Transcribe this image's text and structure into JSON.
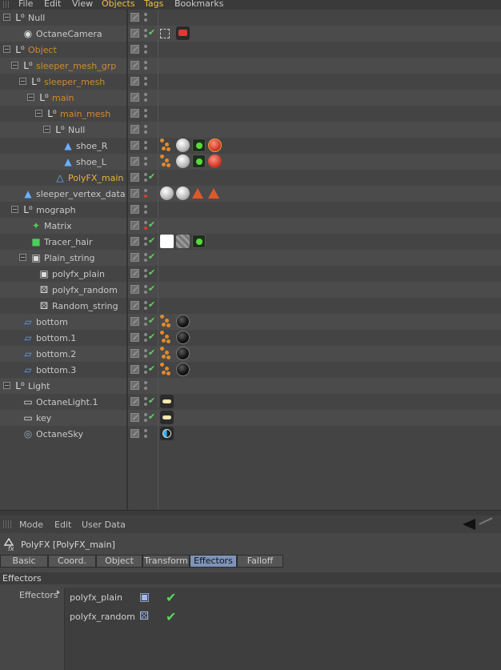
{
  "menubar": {
    "items": [
      "File",
      "Edit",
      "View",
      "Objects",
      "Tags",
      "Bookmarks"
    ]
  },
  "object_manager": {
    "rows": [
      {
        "name": "Null",
        "kind": "null",
        "color": "plain",
        "tags": []
      },
      {
        "name": "OctaneCamera",
        "kind": "camera",
        "color": "plain",
        "tags": [
          "focus",
          "redcam"
        ]
      },
      {
        "name": "Object",
        "kind": "null",
        "color": "orange",
        "tags": []
      },
      {
        "name": "sleeper_mesh_grp",
        "kind": "null",
        "color": "orange",
        "tags": []
      },
      {
        "name": "sleeper_mesh",
        "kind": "null",
        "color": "orange",
        "tags": []
      },
      {
        "name": "main",
        "kind": "null",
        "color": "orange",
        "tags": []
      },
      {
        "name": "main_mesh",
        "kind": "null",
        "color": "orange",
        "tags": []
      },
      {
        "name": "Null",
        "kind": "null",
        "color": "plain",
        "tags": []
      },
      {
        "name": "shoe_R",
        "kind": "poly",
        "color": "plain",
        "tags": [
          "orange-dots",
          "sphere-w",
          "green",
          "red-sel"
        ]
      },
      {
        "name": "shoe_L",
        "kind": "poly",
        "color": "plain",
        "tags": [
          "orange-dots",
          "sphere-w",
          "green",
          "red"
        ]
      },
      {
        "name": "PolyFX_main",
        "kind": "polyfx",
        "color": "yellow",
        "tags": []
      },
      {
        "name": "sleeper_vertex_data",
        "kind": "poly",
        "color": "plain",
        "tags": [
          "sphere-w",
          "sphere-w",
          "tri",
          "tri"
        ]
      },
      {
        "name": "mograph",
        "kind": "null",
        "color": "plain",
        "tags": []
      },
      {
        "name": "Matrix",
        "kind": "matrix",
        "color": "plain",
        "tags": []
      },
      {
        "name": "Tracer_hair",
        "kind": "tracer",
        "color": "plain",
        "tags": [
          "whitebox",
          "hatch",
          "green"
        ]
      },
      {
        "name": "Plain_string",
        "kind": "plain",
        "color": "plain",
        "tags": []
      },
      {
        "name": "polyfx_plain",
        "kind": "plain",
        "color": "plain",
        "tags": []
      },
      {
        "name": "polyfx_random",
        "kind": "random",
        "color": "plain",
        "tags": []
      },
      {
        "name": "Random_string",
        "kind": "random",
        "color": "plain",
        "tags": []
      },
      {
        "name": "bottom",
        "kind": "plane",
        "color": "plain",
        "tags": [
          "orange-dots",
          "sphere-k"
        ]
      },
      {
        "name": "bottom.1",
        "kind": "plane",
        "color": "plain",
        "tags": [
          "orange-dots",
          "sphere-k"
        ]
      },
      {
        "name": "bottom.2",
        "kind": "plane",
        "color": "plain",
        "tags": [
          "orange-dots",
          "sphere-k"
        ]
      },
      {
        "name": "bottom.3",
        "kind": "plane",
        "color": "plain",
        "tags": [
          "orange-dots",
          "sphere-k"
        ]
      },
      {
        "name": "Light",
        "kind": "null",
        "color": "plain",
        "tags": []
      },
      {
        "name": "OctaneLight.1",
        "kind": "light",
        "color": "plain",
        "tags": [
          "light"
        ]
      },
      {
        "name": "key",
        "kind": "light",
        "color": "plain",
        "tags": [
          "light"
        ]
      },
      {
        "name": "OctaneSky",
        "kind": "sky",
        "color": "plain",
        "tags": [
          "sky"
        ]
      }
    ]
  },
  "attribute_manager": {
    "menu": [
      "Mode",
      "Edit",
      "User Data"
    ],
    "object_title": "PolyFX [PolyFX_main]",
    "tabs": [
      "Basic",
      "Coord.",
      "Object",
      "Transform",
      "Effectors",
      "Falloff"
    ],
    "active_tab": "Effectors",
    "section": "Effectors",
    "field_label": "Effectors",
    "effectors": [
      {
        "name": "polyfx_plain",
        "icon": "plain-effector-icon"
      },
      {
        "name": "polyfx_random",
        "icon": "random-effector-icon"
      }
    ]
  },
  "colors": {
    "orange_name": "#d08a30",
    "yellow_name": "#e8b23a",
    "check_green": "#58d858",
    "active_tab": "#7d93b8"
  }
}
